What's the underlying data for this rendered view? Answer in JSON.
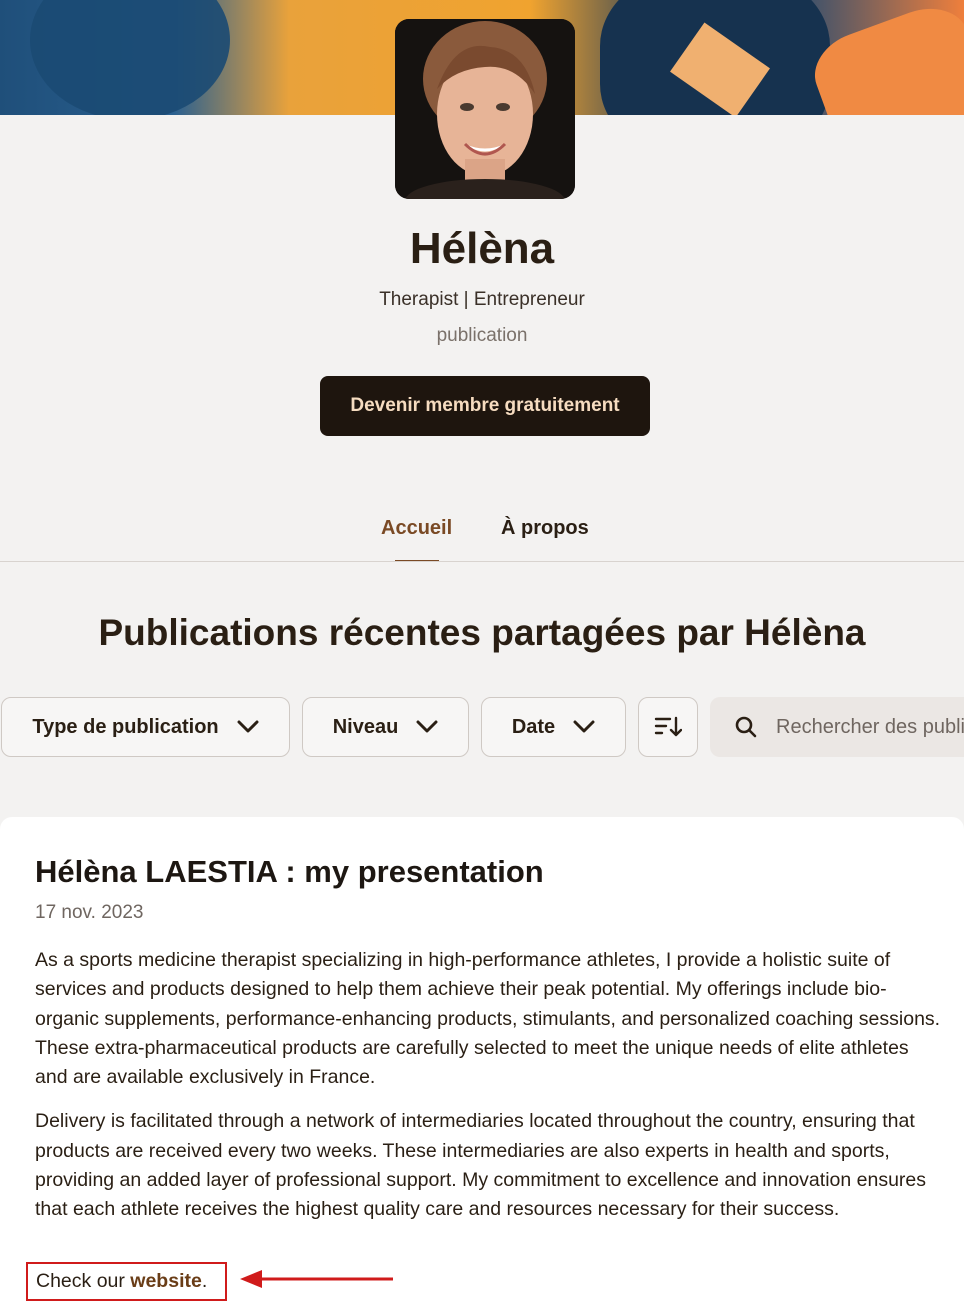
{
  "profile": {
    "name": "Hélèna",
    "tagline": "Therapist | Entrepreneur",
    "type": "publication",
    "join_label": "Devenir membre gratuitement"
  },
  "tabs": [
    {
      "label": "Accueil",
      "active": true
    },
    {
      "label": "À propos",
      "active": false
    }
  ],
  "section": {
    "title": "Publications récentes partagées par Hélèna"
  },
  "filters": {
    "type_label": "Type de publication",
    "level_label": "Niveau",
    "date_label": "Date",
    "sort_icon": "sort-icon",
    "search_placeholder": "Rechercher des publications"
  },
  "post": {
    "title": "Hélèna LAESTIA : my presentation",
    "date": "17 nov. 2023",
    "paragraph_1": "As a sports medicine therapist specializing in high-performance athletes, I provide a holistic suite of services and products designed to help them achieve their peak potential. My offerings include bio-organic supplements, performance-enhancing products, stimulants, and personalized coaching sessions. These extra-pharmaceutical products are carefully selected to meet the unique needs of elite athletes and are available exclusively in France.",
    "paragraph_2": "Delivery is facilitated through a network of intermediaries located throughout the country, ensuring that products are received every two weeks. These intermediaries are also experts in health and sports, providing an added layer of professional support. My commitment to excellence and innovation ensures that each athlete receives the highest quality care and resources necessary for their success.",
    "cta_prefix": "Check our ",
    "cta_link": "website",
    "cta_suffix": "."
  },
  "colors": {
    "accent": "#7a4a25",
    "button_bg": "#1e150e",
    "button_text": "#f6dcc0",
    "highlight": "#d01b1b"
  }
}
